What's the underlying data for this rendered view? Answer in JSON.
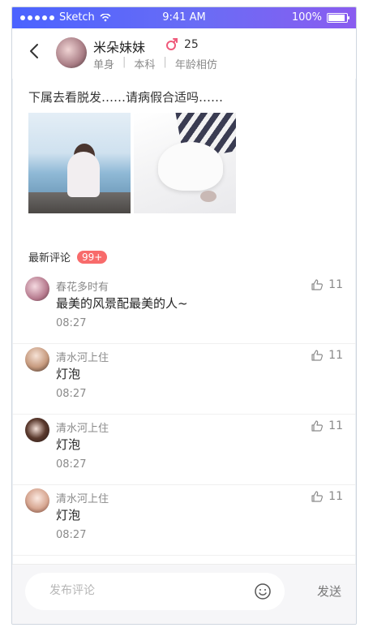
{
  "status_bar": {
    "carrier": "Sketch",
    "time": "9:41 AM",
    "battery": "100%",
    "battery_level": 1.0
  },
  "header": {
    "username": "米朵妹妹",
    "age": "25",
    "meta": [
      "单身",
      "本科",
      "年龄相仿"
    ]
  },
  "post": {
    "text": "下属去看脱发……请病假合适吗……"
  },
  "comments_section": {
    "title": "最新评论",
    "count": "99+"
  },
  "comments": [
    {
      "name": "春花多时有",
      "text": "最美的风景配最美的人~",
      "time": "08:27",
      "likes": "11"
    },
    {
      "name": "清水河上住",
      "text": "灯泡",
      "time": "08:27",
      "likes": "11"
    },
    {
      "name": "清水河上住",
      "text": "灯泡",
      "time": "08:27",
      "likes": "11"
    },
    {
      "name": "清水河上住",
      "text": "灯泡",
      "time": "08:27",
      "likes": "11"
    }
  ],
  "bottom_bar": {
    "placeholder": "发布评论",
    "send": "发送"
  }
}
